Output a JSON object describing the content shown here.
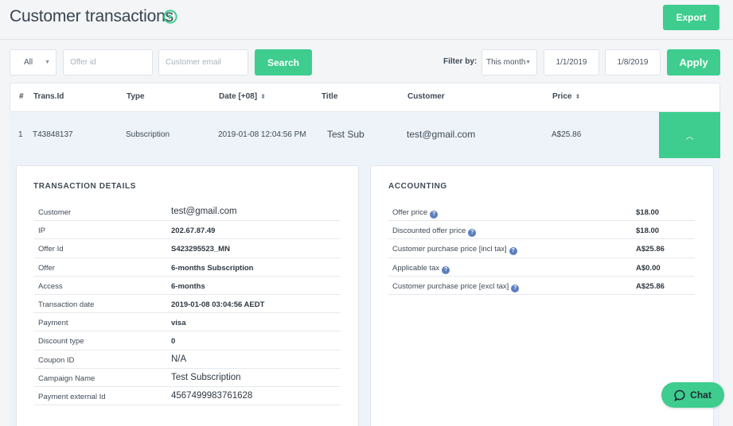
{
  "header": {
    "title": "Customer transactions",
    "export_label": "Export"
  },
  "filters": {
    "type_selected": "All",
    "offer_placeholder": "Offer id",
    "email_placeholder": "Customer email",
    "search_label": "Search",
    "filter_by_label": "Filter by:",
    "period_selected": "This month",
    "date_from": "1/1/2019",
    "date_to": "1/8/2019",
    "apply_label": "Apply"
  },
  "table": {
    "columns": [
      "#",
      "Trans.Id",
      "Type",
      "Date [+08]",
      "Title",
      "Customer",
      "Price"
    ],
    "rows": [
      {
        "num": "1",
        "trans_id": "T43848137",
        "type": "Subscription",
        "date": "2019-01-08 12:04:56 PM",
        "title": "Test Sub",
        "customer": "test@gmail.com",
        "price": "A$25.86"
      }
    ]
  },
  "transaction_details": {
    "title": "TRANSACTION DETAILS",
    "rows": [
      {
        "key": "Customer",
        "value": "test@gmail.com"
      },
      {
        "key": "IP",
        "value": "202.67.87.49"
      },
      {
        "key": "Offer Id",
        "value": "S423295523_MN"
      },
      {
        "key": "Offer",
        "value": "6-months Subscription"
      },
      {
        "key": "Access",
        "value": "6-months"
      },
      {
        "key": "Transaction date",
        "value": "2019-01-08 03:04:56 AEDT"
      },
      {
        "key": "Payment",
        "value": "visa"
      },
      {
        "key": "Discount type",
        "value": "0"
      },
      {
        "key": "Coupon ID",
        "value": "N/A"
      },
      {
        "key": "Campaign Name",
        "value": "Test Subscription"
      },
      {
        "key": "Payment external Id",
        "value": "4567499983761628"
      }
    ]
  },
  "accounting": {
    "title": "ACCOUNTING",
    "rows": [
      {
        "key": "Offer price",
        "value": "$18.00"
      },
      {
        "key": "Discounted offer price",
        "value": "$18.00"
      },
      {
        "key": "Customer purchase price [incl tax]",
        "value": "A$25.86"
      },
      {
        "key": "Applicable tax",
        "value": "A$0.00"
      },
      {
        "key": "Customer purchase price [excl tax]",
        "value": "A$25.86"
      }
    ]
  },
  "chat": {
    "label": "Chat"
  },
  "colors": {
    "accent": "#3ecd8e",
    "help_icon": "#5b7fbf",
    "expanded_row_bg": "#edf3f8"
  },
  "icons": {
    "title_icon": "play-circle-icon",
    "help": "question-circle-icon",
    "expand": "chevron-up-icon",
    "chat": "speech-bubble-icon"
  }
}
